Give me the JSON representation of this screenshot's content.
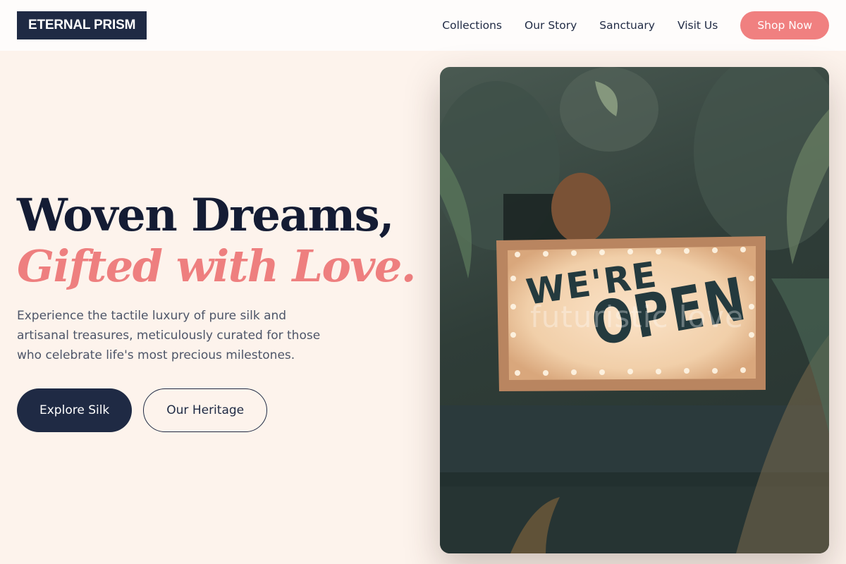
{
  "header": {
    "logo": "ETERNAL PRISM",
    "nav": [
      "Collections",
      "Our Story",
      "Sanctuary",
      "Visit Us"
    ],
    "cta": "Shop Now"
  },
  "hero": {
    "headline_line1": "Woven Dreams,",
    "headline_line2": "Gifted with Love.",
    "subtext": "Experience the tactile luxury of pure silk and artisanal treasures, meticulously curated for those who celebrate life's most precious milestones.",
    "primary_button": "Explore Silk",
    "secondary_button": "Our Heritage"
  },
  "photo": {
    "sign_line1": "WE'RE",
    "sign_line2": "OPEN",
    "watermark": "futuristic love"
  },
  "colors": {
    "navy": "#1f2a44",
    "coral": "#f08080",
    "background": "#fdf3ec"
  }
}
